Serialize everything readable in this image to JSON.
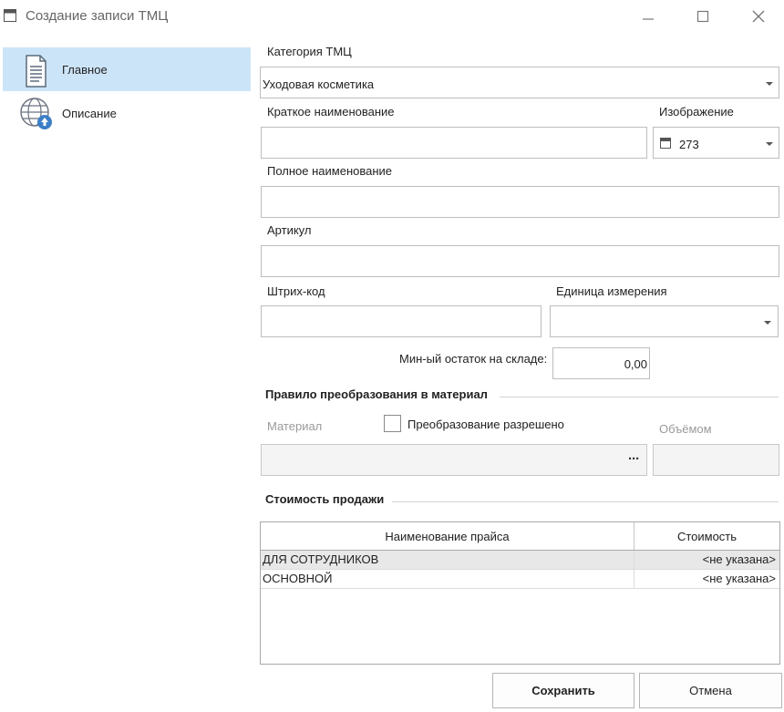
{
  "window": {
    "title": "Создание записи ТМЦ"
  },
  "sidebar": {
    "items": [
      {
        "label": "Главное",
        "icon": "document-icon",
        "selected": true
      },
      {
        "label": "Описание",
        "icon": "globe-upload-icon",
        "selected": false
      }
    ]
  },
  "form": {
    "category": {
      "label": "Категория ТМЦ",
      "value": "Уходовая косметика"
    },
    "short_name": {
      "label": "Краткое наименование",
      "value": ""
    },
    "image": {
      "label": "Изображение",
      "value": "273"
    },
    "full_name": {
      "label": "Полное наименование",
      "value": ""
    },
    "article": {
      "label": "Артикул",
      "value": ""
    },
    "barcode": {
      "label": "Штрих-код",
      "value": ""
    },
    "unit": {
      "label": "Единица измерения",
      "value": ""
    },
    "min_stock": {
      "label": "Мин-ый остаток на складе:",
      "value": "0,00"
    }
  },
  "conversion": {
    "title": "Правило преобразования в материал",
    "material_label": "Материал",
    "allowed_label": "Преобразование разрешено",
    "allowed_checked": false,
    "volume_label": "Объёмом",
    "browse_label": "···",
    "material_value": "",
    "volume_value": ""
  },
  "pricing": {
    "title": "Стоимость продажи",
    "columns": [
      "Наименование прайса",
      "Стоимость"
    ],
    "rows": [
      {
        "name": "ДЛЯ СОТРУДНИКОВ",
        "price": "<не указана>"
      },
      {
        "name": "ОСНОВНОЙ",
        "price": "<не указана>"
      }
    ]
  },
  "buttons": {
    "save": "Сохранить",
    "cancel": "Отмена"
  },
  "colors": {
    "selection": "#cce4f7",
    "icon_blue": "#3c7fc6"
  }
}
